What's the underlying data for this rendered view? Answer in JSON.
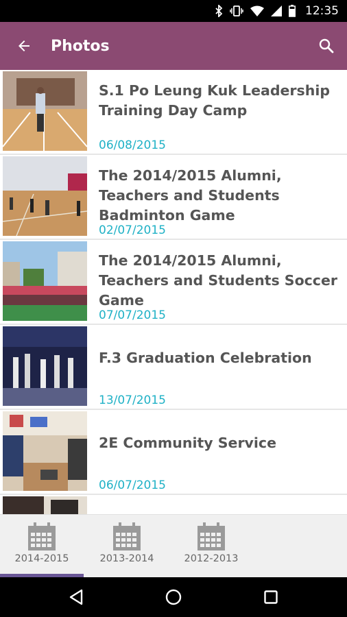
{
  "status_bar": {
    "time": "12:35"
  },
  "app_bar": {
    "title": "Photos"
  },
  "photos": [
    {
      "title": "S.1 Po Leung Kuk Leadership Training Day Camp",
      "date": "06/08/2015"
    },
    {
      "title": "The 2014/2015 Alumni, Teachers and Students Badminton Game",
      "date": "02/07/2015"
    },
    {
      "title": "The 2014/2015 Alumni, Teachers and Students Soccer Game",
      "date": "07/07/2015"
    },
    {
      "title": "F.3 Graduation Celebration",
      "date": "13/07/2015"
    },
    {
      "title": "2E Community Service",
      "date": "06/07/2015"
    }
  ],
  "tabs": [
    {
      "label": "2014-2015",
      "selected": true
    },
    {
      "label": "2013-2014",
      "selected": false
    },
    {
      "label": "2012-2013",
      "selected": false
    }
  ],
  "colors": {
    "app_bar": "#8b4a72",
    "date": "#1fb1c6",
    "tab_indicator": "#6a5796"
  }
}
